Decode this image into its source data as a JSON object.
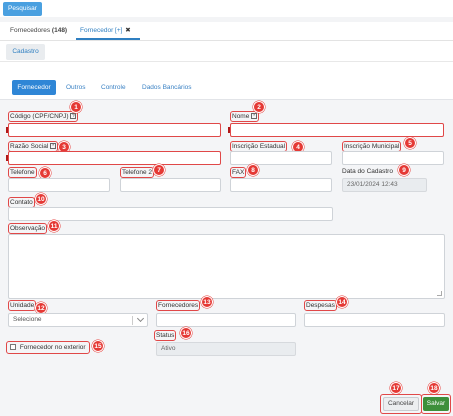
{
  "toolbar": {
    "search_label": "Pesquisar"
  },
  "main_tabs": [
    {
      "label": "Fornecedores",
      "count": "(148)"
    },
    {
      "label": "Fornecedor [+]",
      "close": "✖"
    }
  ],
  "subtabs_header": {
    "label": "Cadastro"
  },
  "form_tabs": [
    "Fornecedor",
    "Outros",
    "Controle",
    "Dados Bancários"
  ],
  "fields": {
    "codigo": {
      "label": "Código (CPF/CNPJ)",
      "help": "?",
      "badge": "1",
      "value": ""
    },
    "nome": {
      "label": "Nome",
      "help": "*",
      "badge": "2",
      "value": ""
    },
    "razao_social": {
      "label": "Razão Social",
      "help": "*",
      "badge": "3",
      "value": ""
    },
    "inscricao_estadual": {
      "label": "Inscrição Estadual",
      "badge": "4",
      "value": ""
    },
    "inscricao_municipal": {
      "label": "Inscrição Municipal",
      "badge": "5",
      "value": ""
    },
    "telefone": {
      "label": "Telefone",
      "badge": "6",
      "value": ""
    },
    "telefone2": {
      "label": "Telefone 2",
      "badge": "7",
      "value": ""
    },
    "fax": {
      "label": "FAX",
      "badge": "8",
      "value": ""
    },
    "data_cadastro": {
      "label": "Data do Cadastro",
      "badge": "9",
      "value": "23/01/2024 12:43"
    },
    "contato": {
      "label": "Contato",
      "badge": "10",
      "value": ""
    },
    "observacao": {
      "label": "Observação",
      "badge": "11",
      "value": ""
    },
    "unidade": {
      "label": "Unidade",
      "badge": "12",
      "value": "Selecione"
    },
    "fornecedores": {
      "label": "Fornecedores",
      "badge": "13",
      "value": ""
    },
    "despesas": {
      "label": "Despesas",
      "badge": "14",
      "value": ""
    },
    "fornecedor_exterior": {
      "label": "Fornecedor no exterior",
      "badge": "15",
      "checked": false
    },
    "status": {
      "label": "Status",
      "badge": "16",
      "value": "Ativo"
    }
  },
  "actions": {
    "cancel_label": "Cancelar",
    "cancel_badge": "17",
    "save_label": "Salvar",
    "save_badge": "18"
  },
  "colors": {
    "primary": "#2f86d6",
    "badge": "#e53935",
    "highlight": "#e04848",
    "save": "#3d8f3a"
  }
}
